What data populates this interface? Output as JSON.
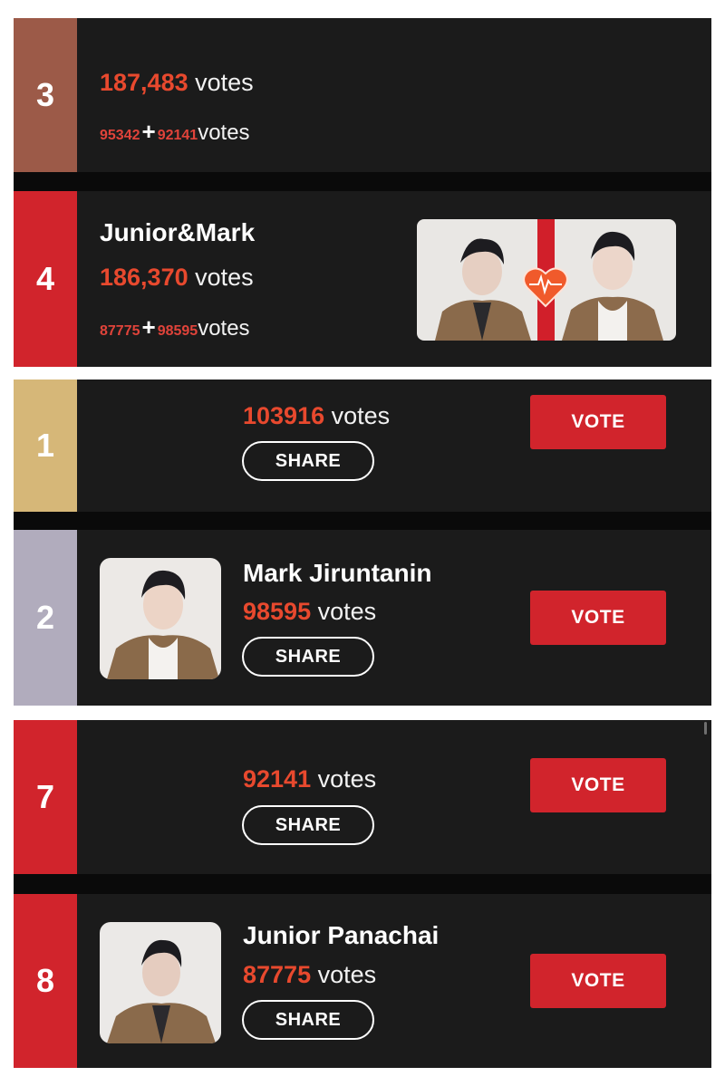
{
  "colors": {
    "rank_3": "#9c5a48",
    "rank_4": "#d1242c",
    "rank_1": "#d6b778",
    "rank_2": "#b1acbd",
    "rank_7": "#d1242c",
    "rank_8": "#d1242c",
    "accent": "#e8492e",
    "vote_button": "#d1242c"
  },
  "pairs": [
    {
      "rank": "3",
      "total": "187,483",
      "votes_word": "votes",
      "part_a": "95342",
      "plus": "+",
      "part_b": "92141",
      "split_word": "votes"
    },
    {
      "rank": "4",
      "name": "Junior&Mark",
      "total": "186,370",
      "votes_word": "votes",
      "part_a": "87775",
      "plus": "+",
      "part_b": "98595",
      "split_word": "votes",
      "image": "junior-and-mark-duo-photo"
    }
  ],
  "singles": [
    {
      "rank": "1",
      "votes": "103916",
      "votes_word": "votes",
      "share_label": "SHARE",
      "vote_label": "VOTE"
    },
    {
      "rank": "2",
      "name": "Mark Jiruntanin",
      "votes": "98595",
      "votes_word": "votes",
      "share_label": "SHARE",
      "vote_label": "VOTE",
      "image": "mark-jiruntanin-photo"
    },
    {
      "rank": "7",
      "votes": "92141",
      "votes_word": "votes",
      "share_label": "SHARE",
      "vote_label": "VOTE"
    },
    {
      "rank": "8",
      "name": "Junior Panachai",
      "votes": "87775",
      "votes_word": "votes",
      "share_label": "SHARE",
      "vote_label": "VOTE",
      "image": "junior-panachai-photo"
    }
  ]
}
